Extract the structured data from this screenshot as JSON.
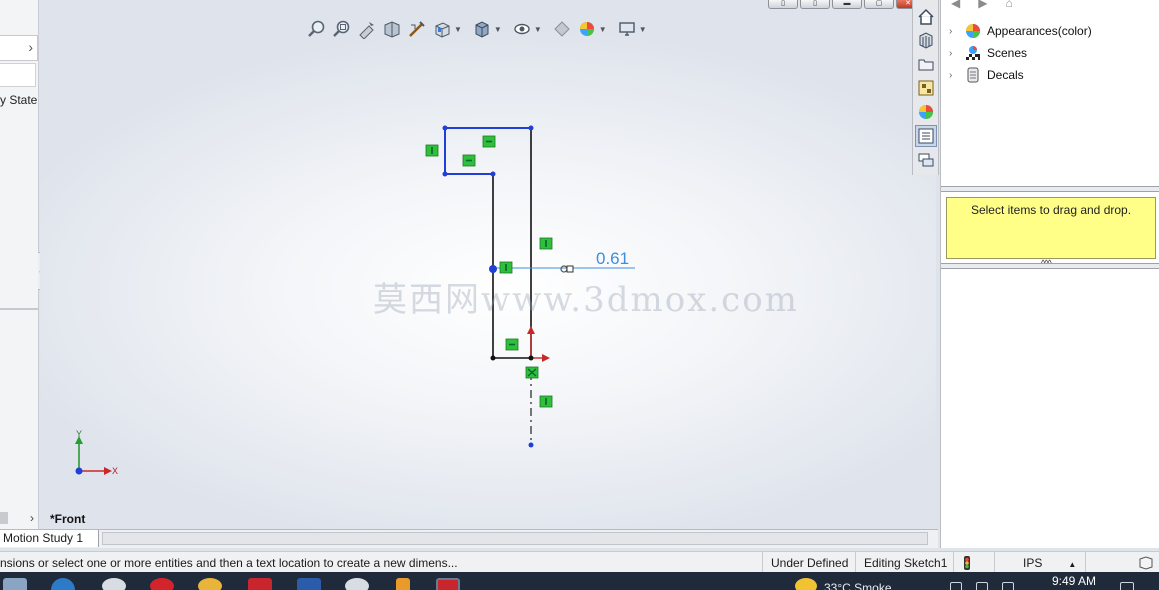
{
  "left_panel": {
    "chevron": "›",
    "state_label": "y State",
    "bottom_chevron": "›"
  },
  "viewport": {
    "view_name": "*Front",
    "dimension_value": "0.61",
    "watermark": "莫西网www.3dmox.com",
    "triad": {
      "y": "Y",
      "x": "X"
    },
    "heads_up_toolbar": [
      "zoom-to-fit-icon",
      "zoom-to-area-icon",
      "previous-view-icon",
      "section-view-icon",
      "dynamic-annotation-icon",
      "view-orientation-icon",
      "display-style-icon",
      "hide-show-items-icon",
      "edit-appearance-icon",
      "apply-scene-icon",
      "view-settings-icon"
    ]
  },
  "task_pane": {
    "items": [
      {
        "label": "Appearances(color)",
        "icon": "appearances-icon"
      },
      {
        "label": "Scenes",
        "icon": "scenes-icon"
      },
      {
        "label": "Decals",
        "icon": "decals-icon"
      }
    ],
    "drag_hint": "Select items to drag and drop.",
    "collapse_glyph": "^^^",
    "tabs": [
      "solidworks-resources-icon",
      "design-library-icon",
      "file-explorer-icon",
      "view-palette-icon",
      "appearances-scenes-decals-icon",
      "custom-properties-icon",
      "forum-icon"
    ]
  },
  "tabs": {
    "motion_study": "Motion Study 1"
  },
  "status_bar": {
    "message": "nsions or select one or more entities and then a text location to create a new dimens...",
    "sketch_state": "Under Defined",
    "editing": "Editing Sketch1",
    "units": "IPS"
  },
  "taskbar": {
    "weather": "33°C  Smoke",
    "time": "9:49 AM"
  },
  "colors": {
    "sketch_blue": "#1f3fd8",
    "sketch_black": "#111111",
    "relation_green": "#2fbf3a",
    "dimension_blue": "#3c8fdc",
    "tooltip_yellow": "#ffff88"
  }
}
